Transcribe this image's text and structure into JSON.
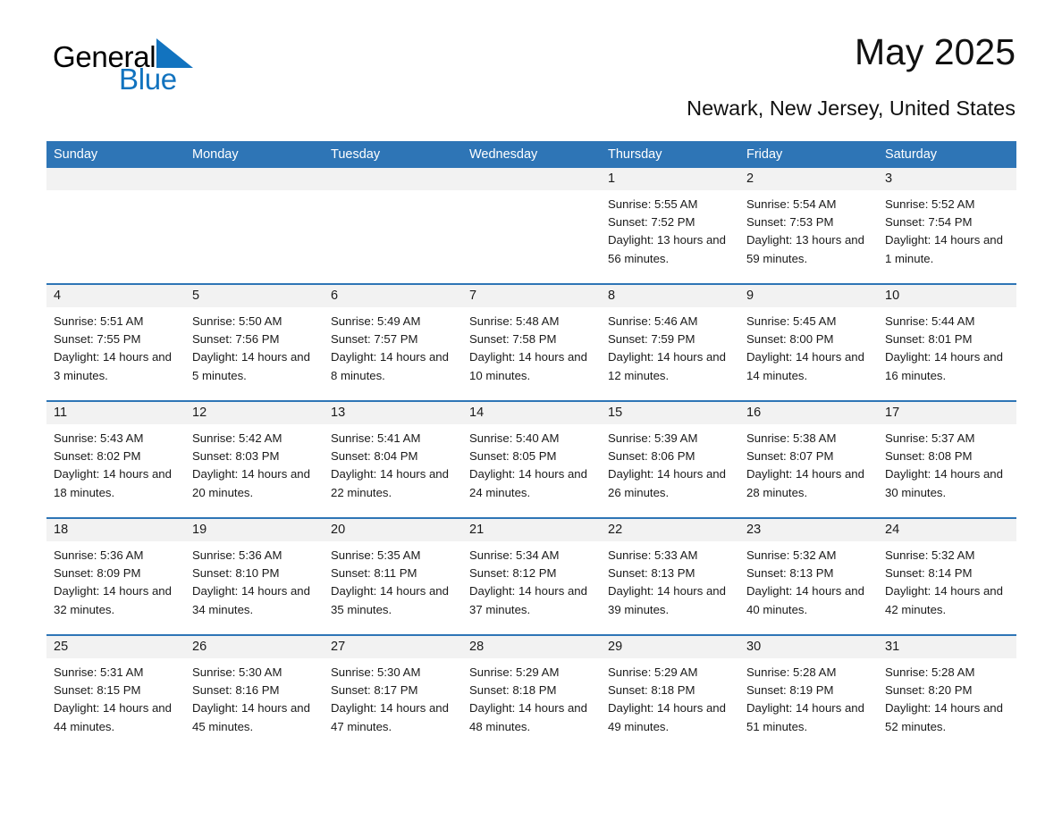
{
  "brand": {
    "name_dark": "General",
    "name_light": "Blue",
    "triangle_color": "#1273bf",
    "icon": "triangle-logo-icon"
  },
  "header": {
    "title": "May 2025",
    "subtitle": "Newark, New Jersey, United States"
  },
  "theme": {
    "header_blue": "#2e75b6",
    "row_band_gray": "#f2f2f2",
    "text_dark": "#1a1a1a"
  },
  "weekdays": [
    "Sunday",
    "Monday",
    "Tuesday",
    "Wednesday",
    "Thursday",
    "Friday",
    "Saturday"
  ],
  "weeks": [
    {
      "days": [
        {
          "num": "",
          "sunrise": "",
          "sunset": "",
          "daylight": ""
        },
        {
          "num": "",
          "sunrise": "",
          "sunset": "",
          "daylight": ""
        },
        {
          "num": "",
          "sunrise": "",
          "sunset": "",
          "daylight": ""
        },
        {
          "num": "",
          "sunrise": "",
          "sunset": "",
          "daylight": ""
        },
        {
          "num": "1",
          "sunrise": "Sunrise: 5:55 AM",
          "sunset": "Sunset: 7:52 PM",
          "daylight": "Daylight: 13 hours and 56 minutes."
        },
        {
          "num": "2",
          "sunrise": "Sunrise: 5:54 AM",
          "sunset": "Sunset: 7:53 PM",
          "daylight": "Daylight: 13 hours and 59 minutes."
        },
        {
          "num": "3",
          "sunrise": "Sunrise: 5:52 AM",
          "sunset": "Sunset: 7:54 PM",
          "daylight": "Daylight: 14 hours and 1 minute."
        }
      ]
    },
    {
      "days": [
        {
          "num": "4",
          "sunrise": "Sunrise: 5:51 AM",
          "sunset": "Sunset: 7:55 PM",
          "daylight": "Daylight: 14 hours and 3 minutes."
        },
        {
          "num": "5",
          "sunrise": "Sunrise: 5:50 AM",
          "sunset": "Sunset: 7:56 PM",
          "daylight": "Daylight: 14 hours and 5 minutes."
        },
        {
          "num": "6",
          "sunrise": "Sunrise: 5:49 AM",
          "sunset": "Sunset: 7:57 PM",
          "daylight": "Daylight: 14 hours and 8 minutes."
        },
        {
          "num": "7",
          "sunrise": "Sunrise: 5:48 AM",
          "sunset": "Sunset: 7:58 PM",
          "daylight": "Daylight: 14 hours and 10 minutes."
        },
        {
          "num": "8",
          "sunrise": "Sunrise: 5:46 AM",
          "sunset": "Sunset: 7:59 PM",
          "daylight": "Daylight: 14 hours and 12 minutes."
        },
        {
          "num": "9",
          "sunrise": "Sunrise: 5:45 AM",
          "sunset": "Sunset: 8:00 PM",
          "daylight": "Daylight: 14 hours and 14 minutes."
        },
        {
          "num": "10",
          "sunrise": "Sunrise: 5:44 AM",
          "sunset": "Sunset: 8:01 PM",
          "daylight": "Daylight: 14 hours and 16 minutes."
        }
      ]
    },
    {
      "days": [
        {
          "num": "11",
          "sunrise": "Sunrise: 5:43 AM",
          "sunset": "Sunset: 8:02 PM",
          "daylight": "Daylight: 14 hours and 18 minutes."
        },
        {
          "num": "12",
          "sunrise": "Sunrise: 5:42 AM",
          "sunset": "Sunset: 8:03 PM",
          "daylight": "Daylight: 14 hours and 20 minutes."
        },
        {
          "num": "13",
          "sunrise": "Sunrise: 5:41 AM",
          "sunset": "Sunset: 8:04 PM",
          "daylight": "Daylight: 14 hours and 22 minutes."
        },
        {
          "num": "14",
          "sunrise": "Sunrise: 5:40 AM",
          "sunset": "Sunset: 8:05 PM",
          "daylight": "Daylight: 14 hours and 24 minutes."
        },
        {
          "num": "15",
          "sunrise": "Sunrise: 5:39 AM",
          "sunset": "Sunset: 8:06 PM",
          "daylight": "Daylight: 14 hours and 26 minutes."
        },
        {
          "num": "16",
          "sunrise": "Sunrise: 5:38 AM",
          "sunset": "Sunset: 8:07 PM",
          "daylight": "Daylight: 14 hours and 28 minutes."
        },
        {
          "num": "17",
          "sunrise": "Sunrise: 5:37 AM",
          "sunset": "Sunset: 8:08 PM",
          "daylight": "Daylight: 14 hours and 30 minutes."
        }
      ]
    },
    {
      "days": [
        {
          "num": "18",
          "sunrise": "Sunrise: 5:36 AM",
          "sunset": "Sunset: 8:09 PM",
          "daylight": "Daylight: 14 hours and 32 minutes."
        },
        {
          "num": "19",
          "sunrise": "Sunrise: 5:36 AM",
          "sunset": "Sunset: 8:10 PM",
          "daylight": "Daylight: 14 hours and 34 minutes."
        },
        {
          "num": "20",
          "sunrise": "Sunrise: 5:35 AM",
          "sunset": "Sunset: 8:11 PM",
          "daylight": "Daylight: 14 hours and 35 minutes."
        },
        {
          "num": "21",
          "sunrise": "Sunrise: 5:34 AM",
          "sunset": "Sunset: 8:12 PM",
          "daylight": "Daylight: 14 hours and 37 minutes."
        },
        {
          "num": "22",
          "sunrise": "Sunrise: 5:33 AM",
          "sunset": "Sunset: 8:13 PM",
          "daylight": "Daylight: 14 hours and 39 minutes."
        },
        {
          "num": "23",
          "sunrise": "Sunrise: 5:32 AM",
          "sunset": "Sunset: 8:13 PM",
          "daylight": "Daylight: 14 hours and 40 minutes."
        },
        {
          "num": "24",
          "sunrise": "Sunrise: 5:32 AM",
          "sunset": "Sunset: 8:14 PM",
          "daylight": "Daylight: 14 hours and 42 minutes."
        }
      ]
    },
    {
      "days": [
        {
          "num": "25",
          "sunrise": "Sunrise: 5:31 AM",
          "sunset": "Sunset: 8:15 PM",
          "daylight": "Daylight: 14 hours and 44 minutes."
        },
        {
          "num": "26",
          "sunrise": "Sunrise: 5:30 AM",
          "sunset": "Sunset: 8:16 PM",
          "daylight": "Daylight: 14 hours and 45 minutes."
        },
        {
          "num": "27",
          "sunrise": "Sunrise: 5:30 AM",
          "sunset": "Sunset: 8:17 PM",
          "daylight": "Daylight: 14 hours and 47 minutes."
        },
        {
          "num": "28",
          "sunrise": "Sunrise: 5:29 AM",
          "sunset": "Sunset: 8:18 PM",
          "daylight": "Daylight: 14 hours and 48 minutes."
        },
        {
          "num": "29",
          "sunrise": "Sunrise: 5:29 AM",
          "sunset": "Sunset: 8:18 PM",
          "daylight": "Daylight: 14 hours and 49 minutes."
        },
        {
          "num": "30",
          "sunrise": "Sunrise: 5:28 AM",
          "sunset": "Sunset: 8:19 PM",
          "daylight": "Daylight: 14 hours and 51 minutes."
        },
        {
          "num": "31",
          "sunrise": "Sunrise: 5:28 AM",
          "sunset": "Sunset: 8:20 PM",
          "daylight": "Daylight: 14 hours and 52 minutes."
        }
      ]
    }
  ]
}
